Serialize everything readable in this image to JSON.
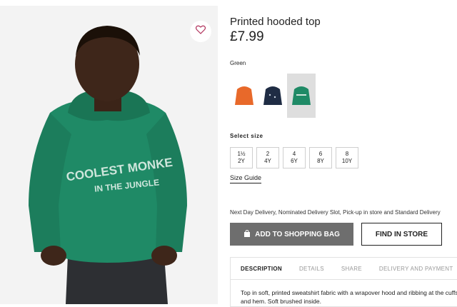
{
  "product": {
    "title": "Printed hooded top",
    "price": "£7.99",
    "hoodie_print_line1": "COOLEST MONKE",
    "hoodie_print_line2": "IN THE JUNGLE"
  },
  "colors": {
    "selected_label": "Green",
    "options": [
      {
        "name": "orange",
        "hex": "#e8692a"
      },
      {
        "name": "navy",
        "hex": "#1f2c44"
      },
      {
        "name": "green",
        "hex": "#1f8a66"
      }
    ]
  },
  "sizes": {
    "label": "Select size",
    "options": [
      {
        "line1": "1½",
        "line2": "2Y"
      },
      {
        "line1": "2",
        "line2": "4Y"
      },
      {
        "line1": "4",
        "line2": "6Y"
      },
      {
        "line1": "6",
        "line2": "8Y"
      },
      {
        "line1": "8",
        "line2": "10Y"
      }
    ],
    "guide_label": "Size Guide"
  },
  "delivery_text": "Next Day Delivery, Nominated Delivery Slot, Pick-up in store and Standard Delivery",
  "actions": {
    "add_to_bag": "ADD TO SHOPPING BAG",
    "find_in_store": "FIND IN STORE"
  },
  "tabs": [
    "DESCRIPTION",
    "DETAILS",
    "SHARE",
    "DELIVERY AND PAYMENT"
  ],
  "description": "Top in soft, printed sweatshirt fabric with a wrapover hood and ribbing at the cuffs and hem. Soft brushed inside.",
  "theme": {
    "hoodie_green": "#1f8a66",
    "bag_button": "#6e6e6e",
    "heart": "#b0305a"
  }
}
